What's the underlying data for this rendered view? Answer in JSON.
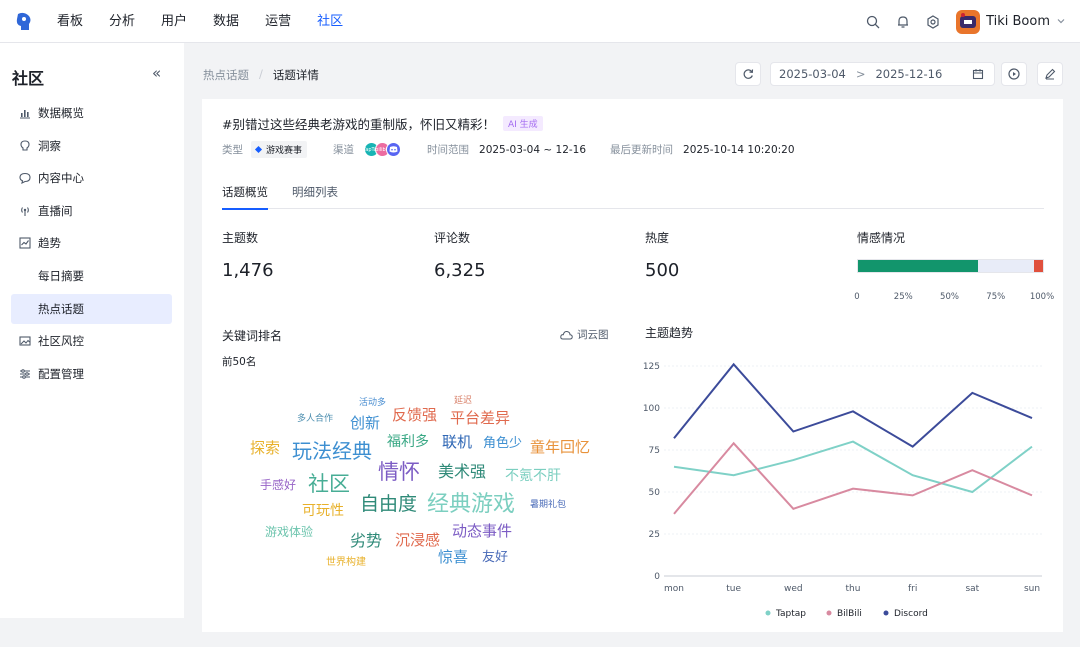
{
  "app": {
    "user": "Tiki Boom"
  },
  "nav": [
    "看板",
    "分析",
    "用户",
    "数据",
    "运营",
    "社区"
  ],
  "nav_active": 5,
  "sidebar": {
    "title": "社区",
    "items": [
      {
        "label": "数据概览",
        "icon": "chart-bar-icon"
      },
      {
        "label": "洞察",
        "icon": "bulb-icon"
      },
      {
        "label": "内容中心",
        "icon": "message-icon"
      },
      {
        "label": "直播间",
        "icon": "broadcast-icon"
      },
      {
        "label": "趋势",
        "icon": "trend-icon"
      },
      {
        "label": "每日摘要",
        "icon": ""
      },
      {
        "label": "热点话题",
        "icon": ""
      },
      {
        "label": "社区风控",
        "icon": "image-shield-icon"
      },
      {
        "label": "配置管理",
        "icon": "settings-sliders-icon"
      }
    ],
    "active": 6
  },
  "breadcrumb": {
    "parent": "热点话题",
    "sep": "/",
    "current": "话题详情"
  },
  "date_range": {
    "start": "2025-03-04",
    "arrow": ">",
    "end": "2025-12-16"
  },
  "topic": {
    "title": "#别错过这些经典老游戏的重制版，怀旧又精彩！",
    "ai_tag": "AI 生成",
    "type_label": "类型",
    "type_value": "游戏赛事",
    "channel_label": "渠道",
    "channel_badges": [
      "TapTap",
      "bilibili",
      "Discord"
    ],
    "range_label": "时间范围",
    "range_value": "2025-03-04 ~ 12-16",
    "updated_label": "最后更新时间",
    "updated_value": "2025-10-14 10:20:20"
  },
  "tabs": [
    "话题概览",
    "明细列表"
  ],
  "tab_active": 0,
  "metrics": [
    {
      "label": "主题数",
      "value": "1,476"
    },
    {
      "label": "评论数",
      "value": "6,325"
    },
    {
      "label": "热度",
      "value": "500"
    }
  ],
  "sentiment": {
    "label": "情感情况",
    "positive_fraction": 0.65,
    "negative_fraction": 0.05,
    "ticks": [
      "0",
      "25%",
      "50%",
      "75%",
      "100%"
    ],
    "colors": {
      "positive": "#12956c",
      "neutral": "#e8ecf8",
      "negative": "#e0503d"
    }
  },
  "keyword": {
    "title": "关键词排名",
    "wordcloud_btn": "词云图",
    "subtitle": "前50名",
    "words": [
      {
        "t": "活动多",
        "c": "#4a8ed1",
        "s": 9
      },
      {
        "t": "延迟",
        "c": "#d9826b",
        "s": 9
      },
      {
        "t": "多人合作",
        "c": "#4e8fb0",
        "s": 9
      },
      {
        "t": "创新",
        "c": "#3d8fd1",
        "s": 15
      },
      {
        "t": "反馈强",
        "c": "#e06a4e",
        "s": 15
      },
      {
        "t": "平台差异",
        "c": "#e06a4e",
        "s": 15
      },
      {
        "t": "探索",
        "c": "#e8b12b",
        "s": 15
      },
      {
        "t": "玩法经典",
        "c": "#3d8fd1",
        "s": 20
      },
      {
        "t": "福利多",
        "c": "#3aa885",
        "s": 14
      },
      {
        "t": "联机",
        "c": "#2f67b5",
        "s": 15
      },
      {
        "t": "角色少",
        "c": "#3d8fd1",
        "s": 13
      },
      {
        "t": "童年回忆",
        "c": "#e8923a",
        "s": 15
      },
      {
        "t": "手感好",
        "c": "#9865c7",
        "s": 12
      },
      {
        "t": "社区",
        "c": "#47ad95",
        "s": 21
      },
      {
        "t": "情怀",
        "c": "#7c5cc4",
        "s": 21
      },
      {
        "t": "美术强",
        "c": "#2f8a78",
        "s": 16
      },
      {
        "t": "不氪不肝",
        "c": "#7ccfc0",
        "s": 14
      },
      {
        "t": "可玩性",
        "c": "#e8b12b",
        "s": 14
      },
      {
        "t": "自由度",
        "c": "#2f8a78",
        "s": 19
      },
      {
        "t": "经典游戏",
        "c": "#7ccfc0",
        "s": 22
      },
      {
        "t": "暑期礼包",
        "c": "#4a6bb8",
        "s": 9
      },
      {
        "t": "游戏体验",
        "c": "#6cc4ad",
        "s": 12
      },
      {
        "t": "劣势",
        "c": "#2f8a78",
        "s": 16
      },
      {
        "t": "沉浸感",
        "c": "#e06a4e",
        "s": 15
      },
      {
        "t": "动态事件",
        "c": "#7c5cc4",
        "s": 15
      },
      {
        "t": "世界构建",
        "c": "#e8b12b",
        "s": 10
      },
      {
        "t": "惊喜",
        "c": "#3d8fd1",
        "s": 15
      },
      {
        "t": "友好",
        "c": "#4a6bb8",
        "s": 13
      }
    ]
  },
  "trend": {
    "title": "主题趋势"
  },
  "chart_data": {
    "type": "line",
    "title": "主题趋势",
    "categories": [
      "mon",
      "tue",
      "wed",
      "thu",
      "fri",
      "sat",
      "sun"
    ],
    "ylim": [
      0,
      125
    ],
    "yticks": [
      0,
      25,
      50,
      75,
      100,
      125
    ],
    "grid": true,
    "legend_position": "bottom",
    "series": [
      {
        "name": "Taptap",
        "color": "#7fd1c7",
        "values": [
          65,
          60,
          69,
          80,
          60,
          50,
          77
        ]
      },
      {
        "name": "BilBili",
        "color": "#d88aa0",
        "values": [
          37,
          79,
          40,
          52,
          48,
          63,
          48
        ]
      },
      {
        "name": "Discord",
        "color": "#3c4b9a",
        "values": [
          82,
          126,
          86,
          98,
          77,
          109,
          94
        ]
      }
    ]
  }
}
